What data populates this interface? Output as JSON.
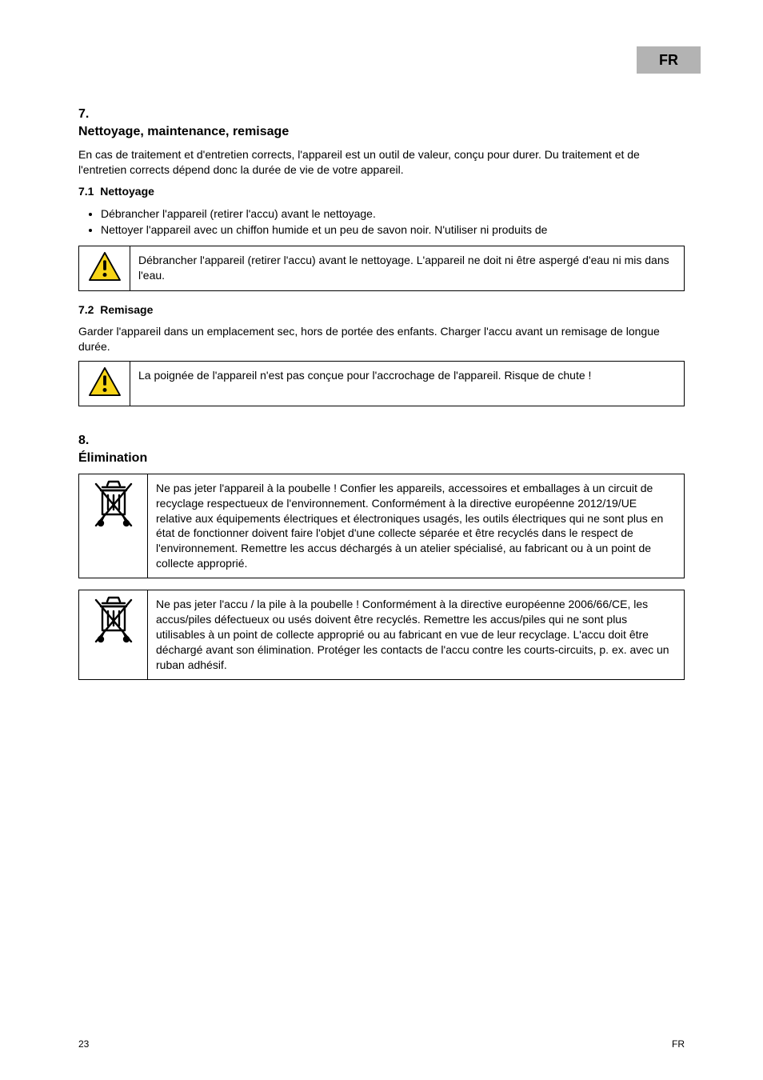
{
  "langTab": "FR",
  "s1": {
    "num": "7.",
    "title": "Nettoyage, maintenance, remisage",
    "p1": "En cas de traitement et d'entretien corrects, l'appareil est un outil de valeur, conçu pour durer. Du traitement et de l'entretien corrects dépend donc la durée de vie de votre appareil.",
    "sub1": {
      "num": "7.1",
      "title": "Nettoyage",
      "bullets": [
        "Débrancher l'appareil (retirer l'accu) avant le nettoyage.",
        "Nettoyer l'appareil avec un chiffon humide et un peu de savon noir. N'utiliser ni produits de"
      ],
      "warn": "Débrancher l'appareil (retirer l'accu) avant le nettoyage. L'appareil ne doit ni être aspergé d'eau ni mis dans l'eau."
    },
    "sub2": {
      "num": "7.2",
      "title": "Remisage",
      "p": "Garder l'appareil dans un emplacement sec, hors de portée des enfants. Charger l'accu avant un remisage de longue durée.",
      "warn": "La poignée de l'appareil n'est pas conçue pour l'accrochage de l'appareil. Risque de chute !"
    }
  },
  "s2": {
    "num": "8.",
    "title": "Élimination",
    "box1": "Ne pas jeter l'appareil à la poubelle ! Confier les appareils, accessoires et emballages à un circuit de recyclage respectueux de l'environnement. Conformément à la directive européenne 2012/19/UE relative aux équipements électriques et électroniques usagés, les outils électriques qui ne sont plus en état de fonctionner doivent faire l'objet d'une collecte séparée et être recyclés dans le respect de l'environnement. Remettre les accus déchargés à un atelier spécialisé, au fabricant ou à un point de collecte approprié.",
    "box2": "Ne pas jeter l'accu / la pile à la poubelle ! Conformément à la directive européenne 2006/66/CE, les accus/piles défectueux ou usés doivent être recyclés. Remettre les accus/piles qui ne sont plus utilisables à un point de collecte approprié ou au fabricant en vue de leur recyclage. L'accu doit être déchargé avant son élimination. Protéger les contacts de l'accu contre les courts-circuits, p. ex. avec un ruban adhésif."
  },
  "footer": {
    "left": "23",
    "right": "FR"
  }
}
